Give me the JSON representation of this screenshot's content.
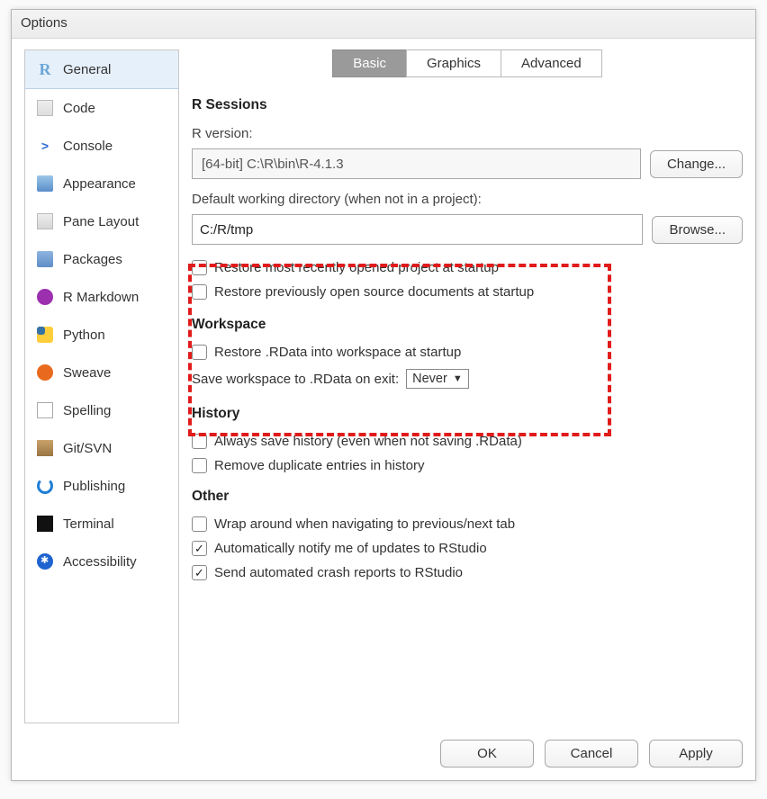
{
  "dialog": {
    "title": "Options"
  },
  "sidebar": {
    "items": [
      {
        "label": "General",
        "icon": "r-logo-icon"
      },
      {
        "label": "Code",
        "icon": "code-icon"
      },
      {
        "label": "Console",
        "icon": "console-icon"
      },
      {
        "label": "Appearance",
        "icon": "appearance-icon"
      },
      {
        "label": "Pane Layout",
        "icon": "pane-layout-icon"
      },
      {
        "label": "Packages",
        "icon": "packages-icon"
      },
      {
        "label": "R Markdown",
        "icon": "rmarkdown-icon"
      },
      {
        "label": "Python",
        "icon": "python-icon"
      },
      {
        "label": "Sweave",
        "icon": "sweave-icon"
      },
      {
        "label": "Spelling",
        "icon": "spelling-icon"
      },
      {
        "label": "Git/SVN",
        "icon": "git-svn-icon"
      },
      {
        "label": "Publishing",
        "icon": "publishing-icon"
      },
      {
        "label": "Terminal",
        "icon": "terminal-icon"
      },
      {
        "label": "Accessibility",
        "icon": "accessibility-icon"
      }
    ],
    "selected": "General"
  },
  "tabs": {
    "items": [
      "Basic",
      "Graphics",
      "Advanced"
    ],
    "active": "Basic"
  },
  "sessions": {
    "heading": "R Sessions",
    "r_version_label": "R version:",
    "r_version_value": "[64-bit] C:\\R\\bin\\R-4.1.3",
    "change_btn": "Change...",
    "default_wd_label": "Default working directory (when not in a project):",
    "default_wd_value": "C:/R/tmp",
    "browse_btn": "Browse...",
    "restore_project_label": "Restore most recently opened project at startup",
    "restore_project_checked": false,
    "restore_source_label": "Restore previously open source documents at startup",
    "restore_source_checked": false
  },
  "workspace": {
    "heading": "Workspace",
    "restore_rdata_label": "Restore .RData into workspace at startup",
    "restore_rdata_checked": false,
    "save_label": "Save workspace to .RData on exit:",
    "save_value": "Never"
  },
  "history": {
    "heading": "History",
    "always_save_label": "Always save history (even when not saving .RData)",
    "always_save_checked": false,
    "remove_dup_label": "Remove duplicate entries in history",
    "remove_dup_checked": false
  },
  "other": {
    "heading": "Other",
    "wrap_label": "Wrap around when navigating to previous/next tab",
    "wrap_checked": false,
    "notify_label": "Automatically notify me of updates to RStudio",
    "notify_checked": true,
    "crash_label": "Send automated crash reports to RStudio",
    "crash_checked": true
  },
  "footer": {
    "ok": "OK",
    "cancel": "Cancel",
    "apply": "Apply"
  },
  "annotation": {
    "highlight_color": "#e11b1b"
  }
}
